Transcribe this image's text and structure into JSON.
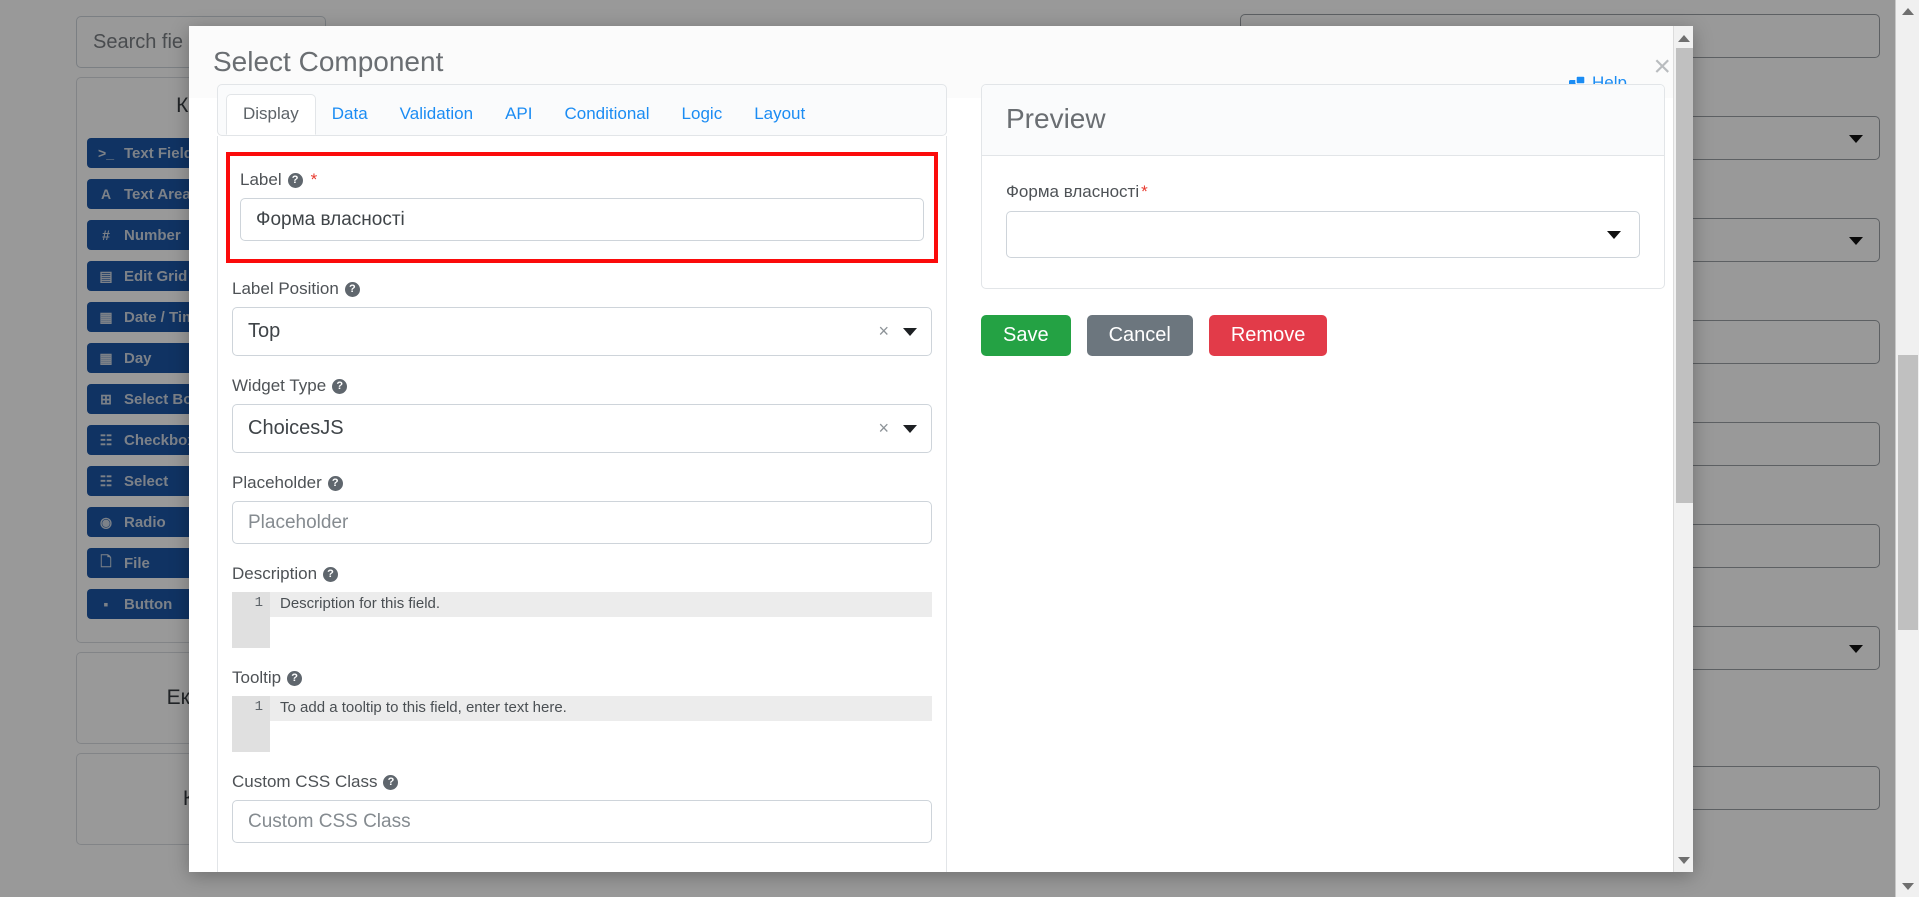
{
  "background": {
    "search": {
      "placeholder": "Search fie"
    },
    "components_panel": {
      "heading": "Комп",
      "items": [
        {
          "icon": "terminal-icon",
          "glyph": ">_",
          "label": "Text Field"
        },
        {
          "icon": "text-area-icon",
          "glyph": "A",
          "label": "Text Area"
        },
        {
          "icon": "number-icon",
          "glyph": "#",
          "label": "Number"
        },
        {
          "icon": "edit-grid-icon",
          "glyph": "▤",
          "label": "Edit Grid"
        },
        {
          "icon": "calendar-icon",
          "glyph": "▦",
          "label": "Date / Tim"
        },
        {
          "icon": "calendar-icon",
          "glyph": "▦",
          "label": "Day"
        },
        {
          "icon": "select-boxes-icon",
          "glyph": "⊞",
          "label": "Select Box"
        },
        {
          "icon": "checkbox-icon",
          "glyph": "☷",
          "label": "Checkbox"
        },
        {
          "icon": "select-icon",
          "glyph": "☷",
          "label": "Select"
        },
        {
          "icon": "radio-icon",
          "glyph": "◉",
          "label": "Radio"
        },
        {
          "icon": "file-icon",
          "glyph": "🗋",
          "label": "File"
        },
        {
          "icon": "button-icon",
          "glyph": "▪",
          "label": "Button"
        }
      ]
    },
    "sections": [
      {
        "heading": "Експер"
      },
      {
        "heading": "Кла"
      }
    ]
  },
  "modal": {
    "title": "Select Component",
    "close_label": "×",
    "help_label": "Help",
    "tabs": [
      {
        "label": "Display",
        "active": true
      },
      {
        "label": "Data",
        "active": false
      },
      {
        "label": "Validation",
        "active": false
      },
      {
        "label": "API",
        "active": false
      },
      {
        "label": "Conditional",
        "active": false
      },
      {
        "label": "Logic",
        "active": false
      },
      {
        "label": "Layout",
        "active": false
      }
    ],
    "fields": {
      "label": {
        "label": "Label",
        "required_marker": "*",
        "value": "Форма власності"
      },
      "label_position": {
        "label": "Label Position",
        "value": "Top",
        "clear_glyph": "×"
      },
      "widget_type": {
        "label": "Widget Type",
        "value": "ChoicesJS",
        "clear_glyph": "×"
      },
      "placeholder": {
        "label": "Placeholder",
        "placeholder": "Placeholder"
      },
      "description": {
        "label": "Description",
        "line_number": "1",
        "placeholder": "Description for this field."
      },
      "tooltip": {
        "label": "Tooltip",
        "line_number": "1",
        "placeholder": "To add a tooltip to this field, enter text here."
      },
      "custom_css_class": {
        "label": "Custom CSS Class",
        "placeholder": "Custom CSS Class"
      }
    },
    "preview": {
      "title": "Preview",
      "field_label": "Форма власності",
      "required_marker": "*",
      "select_value": ""
    },
    "actions": {
      "save": "Save",
      "cancel": "Cancel",
      "remove": "Remove"
    }
  },
  "colors": {
    "accent_blue": "#1b8cf3",
    "component_blue": "#1b55a5",
    "save_green": "#24a244",
    "cancel_gray": "#6c767e",
    "remove_red": "#e23b49",
    "highlight_red": "#fb0b0b",
    "required_red": "#e8392e"
  }
}
